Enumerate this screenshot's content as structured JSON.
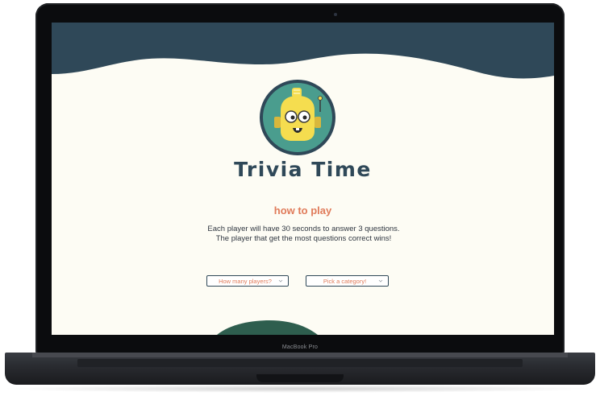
{
  "device": {
    "model_label": "MacBook Pro"
  },
  "app": {
    "title": "Trivia Time",
    "how_to_play_heading": "how to play",
    "instructions": "Each player will have 30 seconds to answer 3 questions. The player that get the most questions correct wins!",
    "players_select": {
      "selected": "How many players?"
    },
    "category_select": {
      "selected": "Pick a category!"
    }
  },
  "icons": {
    "mascot": "robot-mascot-icon",
    "dropdown": "chevron-down-icon"
  },
  "colors": {
    "navy": "#2f4858",
    "teal": "#4a9d8e",
    "cream": "#fdfcf4",
    "coral": "#e07b5a",
    "robot_yellow": "#f5dd4f",
    "dark_green": "#2e5e4e"
  }
}
